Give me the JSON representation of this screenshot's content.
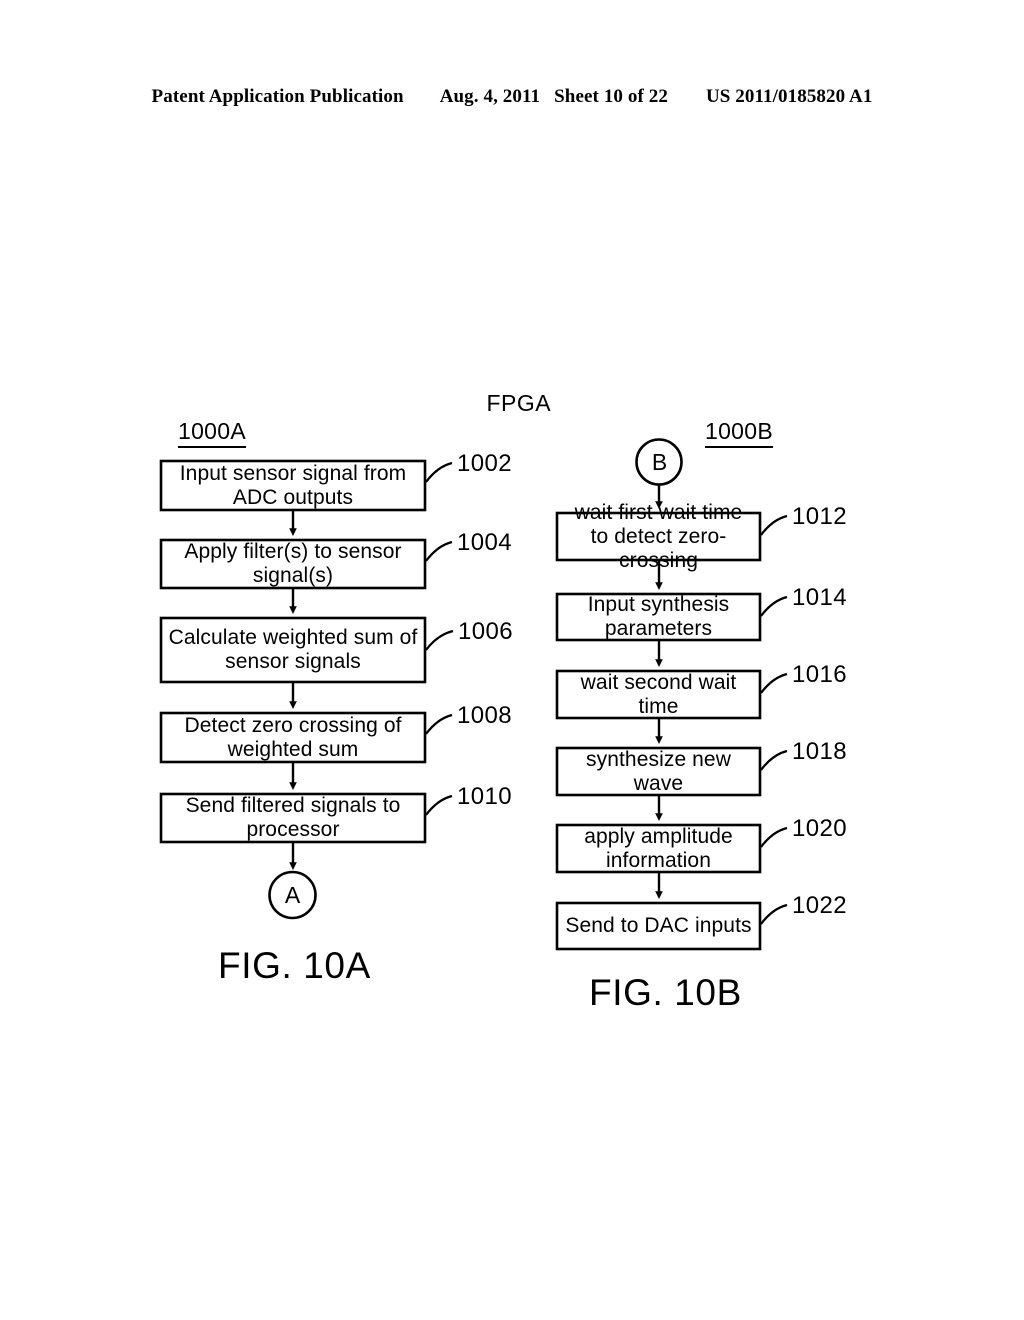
{
  "header": {
    "publication": "Patent Application Publication",
    "date": "Aug. 4, 2011",
    "sheet": "Sheet 10 of 22",
    "patent_number": "US 2011/0185820 A1"
  },
  "figure": {
    "system_title": "FPGA",
    "caption_a": "FIG. 10A",
    "caption_b": "FIG. 10B"
  },
  "flow_a": {
    "id_label": "1000A",
    "steps": [
      {
        "ref": "1002",
        "text": "Input sensor signal from ADC outputs"
      },
      {
        "ref": "1004",
        "text": "Apply filter(s)  to sensor signal(s)"
      },
      {
        "ref": "1006",
        "text": "Calculate weighted sum of sensor signals"
      },
      {
        "ref": "1008",
        "text": "Detect zero crossing of weighted sum"
      },
      {
        "ref": "1010",
        "text": "Send filtered signals to processor"
      }
    ],
    "exit_connector": "A"
  },
  "flow_b": {
    "id_label": "1000B",
    "entry_connector": "B",
    "steps": [
      {
        "ref": "1012",
        "text": "wait first wait time to detect zero-crossing"
      },
      {
        "ref": "1014",
        "text": "Input synthesis parameters"
      },
      {
        "ref": "1016",
        "text": "wait second wait time"
      },
      {
        "ref": "1018",
        "text": "synthesize new wave"
      },
      {
        "ref": "1020",
        "text": "apply amplitude information"
      },
      {
        "ref": "1022",
        "text": "Send to DAC inputs"
      }
    ]
  },
  "colors": {
    "ink": "#000000",
    "paper": "#ffffff"
  }
}
